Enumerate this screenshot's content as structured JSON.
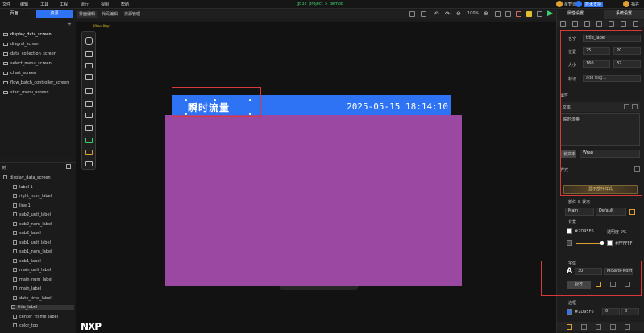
{
  "menubar": {
    "items": [
      "文件",
      "编辑",
      "工具",
      "工程",
      "运行",
      "视图",
      "帮助"
    ],
    "project_title": "gd32_project_5_demo8",
    "user_label": "星智迪",
    "top_right_btn": "技术支持",
    "account_label": "福卉"
  },
  "left_tabs": [
    "页面",
    "资源"
  ],
  "screens": [
    "display_data_screen",
    "diagral_screen",
    "data_collection_screen",
    "select_menu_screen",
    "chart_screen",
    "flow_batch_controller_screen",
    "start_menu_screen"
  ],
  "tree": {
    "header": "树",
    "items": [
      "display_data_screen",
      "label 1",
      "right_num_label",
      "line 1",
      "sub2_unit_label",
      "sub2_num_label",
      "sub2_label",
      "sub1_unit_label",
      "sub1_num_label",
      "sub1_label",
      "main_unit_label",
      "main_num_label",
      "main_label",
      "date_time_label",
      "title_label",
      "center_frame_label",
      "color_top"
    ]
  },
  "canvas_tabs": [
    "界面编辑",
    "代码编辑",
    "资源管理"
  ],
  "zoom": "100%",
  "canvas": {
    "resolution_hint": "800x480px",
    "title_label_text": "瞬时流量",
    "datetime_text": "2025-05-15  18:14:10",
    "logo": "NXP"
  },
  "right_panel": {
    "tabs": [
      "属性设置",
      "系统设置"
    ],
    "name_label": "名字",
    "name_value": "title_label",
    "pos_label": "位置",
    "pos_x": "25",
    "pos_y": "20",
    "size_label": "大小",
    "size_w": "160",
    "size_h": "37",
    "tag_label": "标识",
    "tag_value": "add flag...",
    "props_header": "属性",
    "text_label": "文本",
    "text_value": "瞬时流量",
    "wrap_label": "长文本",
    "wrap_value": "Wrap",
    "style_header": "样式",
    "style_btn": "显示部件样式",
    "state_label": "部件 & 状态",
    "state_part": "Main",
    "state_value": "Default",
    "bg_label": "背景",
    "bg_color": "#2D2D2D",
    "bg_color_label": "#2D95F6",
    "opacity_label": "透明度 0%",
    "grad_color": "#FFFFFF",
    "font_header": "字体",
    "font_size": "30",
    "font_name": "MiSans-Normal",
    "align_label": "对齐",
    "border_header": "边框",
    "border_color": "#2D95F6",
    "border_x": "0",
    "border_y": "0",
    "accent": "#2f73f5"
  }
}
